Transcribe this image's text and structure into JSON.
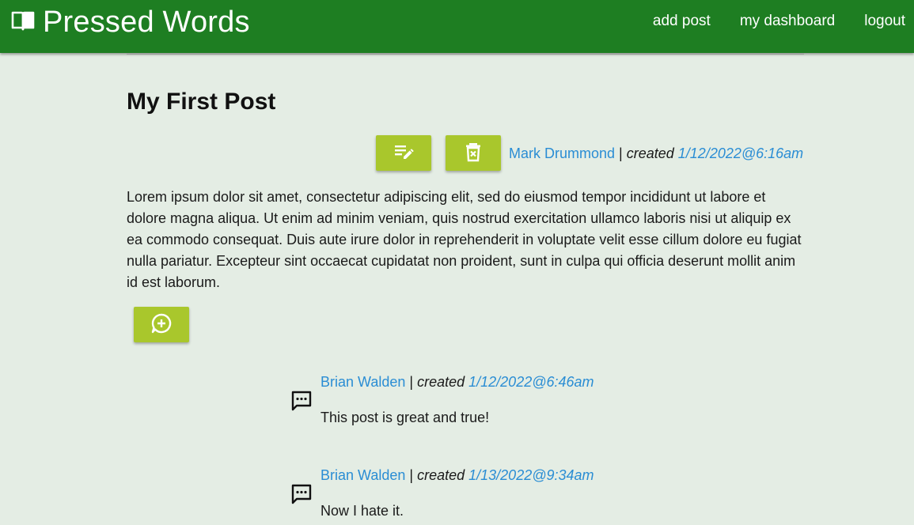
{
  "brand": {
    "name": "Pressed Words",
    "icon": "open-book-icon"
  },
  "nav": {
    "add_post": "add post",
    "dashboard": "my dashboard",
    "logout": "logout"
  },
  "post": {
    "title": "My First Post",
    "author": "Mark Drummond",
    "separator": " | ",
    "created_label": "created",
    "date": "1/12/2022@6:16am",
    "body": "Lorem ipsum dolor sit amet, consectetur adipiscing elit, sed do eiusmod tempor incididunt ut labore et dolore magna aliqua. Ut enim ad minim veniam, quis nostrud exercitation ullamco laboris nisi ut aliquip ex ea commodo consequat. Duis aute irure dolor in reprehenderit in voluptate velit esse cillum dolore eu fugiat nulla pariatur. Excepteur sint occaecat cupidatat non proident, sunt in culpa qui officia deserunt mollit anim id est laborum.",
    "edit_icon": "edit-notes-icon",
    "delete_icon": "trash-icon",
    "add_comment_icon": "add-comment-icon"
  },
  "comments": [
    {
      "author": "Brian Walden",
      "separator": " | ",
      "created_label": "created",
      "date": "1/12/2022@6:46am",
      "text": "This post is great and true!",
      "icon": "comment-bubble-icon"
    },
    {
      "author": "Brian Walden",
      "separator": " | ",
      "created_label": "created",
      "date": "1/13/2022@9:34am",
      "text": "Now I hate it.",
      "icon": "comment-bubble-icon"
    }
  ],
  "colors": {
    "navbar": "#1e7e22",
    "background": "#e4ede4",
    "button": "#a9c72c",
    "link": "#2a8dd4"
  }
}
